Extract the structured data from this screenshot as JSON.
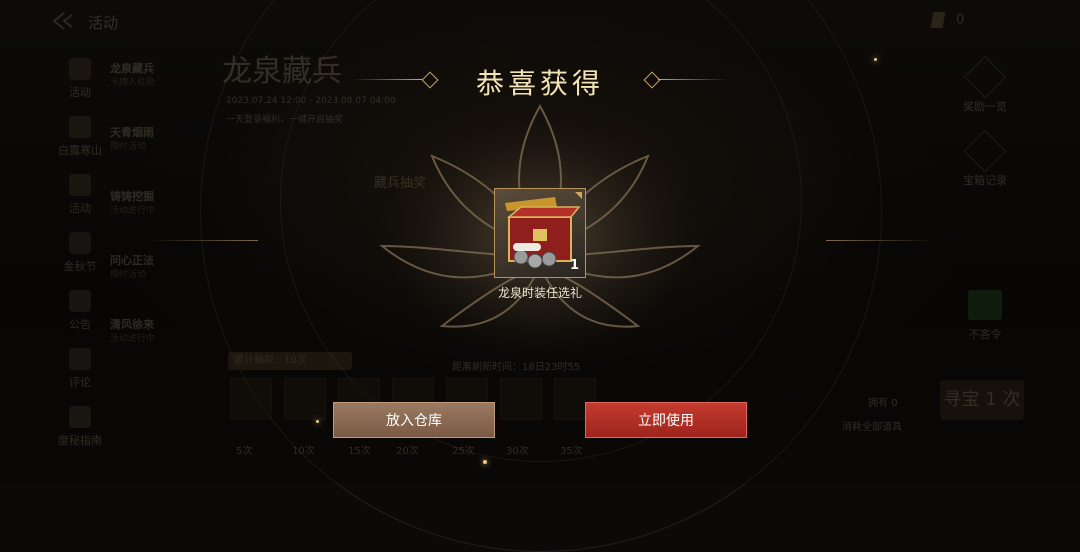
{
  "header": {
    "back_label": "活动",
    "currency_value": "0"
  },
  "sidebar": {
    "items": [
      {
        "label": "活动"
      },
      {
        "label": "白露寒山"
      },
      {
        "label": "活动"
      },
      {
        "label": "金秋节"
      },
      {
        "label": "公告"
      },
      {
        "label": "评论"
      },
      {
        "label": "度秘指南"
      }
    ]
  },
  "subnav": {
    "items": [
      {
        "label": "龙泉藏兵",
        "sub": "卡牌入驻处"
      },
      {
        "label": "天青烟雨",
        "sub": "限时活动"
      },
      {
        "label": "铸铸挖掘",
        "sub": "活动进行中"
      },
      {
        "label": "问心正法",
        "sub": "限时活动"
      },
      {
        "label": "清风徐来",
        "sub": "活动进行中"
      }
    ]
  },
  "event": {
    "title": "龙泉藏兵",
    "date": "2023.07.24 12:00 - 2023.08.07 04:00",
    "desc": "一天登录福利，一键开启抽奖",
    "mid_label": "藏兵抽奖",
    "progress_label": "累计抽取：10次",
    "countdown_label": "距离刷新时间：18日23时55",
    "ticks": [
      "5次",
      "10次",
      "15次",
      "20次",
      "25次",
      "30次",
      "35次"
    ],
    "right_items": [
      {
        "label": "奖励一览"
      },
      {
        "label": "宝箱记录"
      },
      {
        "label": "不吝令"
      }
    ],
    "draw_label": "寻宝 1 次",
    "owned_label": "拥有",
    "owned_value": "0",
    "consume_note": "消耗全部道具"
  },
  "modal": {
    "title": "恭喜获得",
    "item_name": "龙泉时装任选礼",
    "item_qty": "1",
    "btn_store": "放入仓库",
    "btn_use": "立即使用"
  },
  "colors": {
    "accent_gold": "#c9a86a",
    "use_red": "#b7302a",
    "store_brown": "#8a6a52"
  }
}
